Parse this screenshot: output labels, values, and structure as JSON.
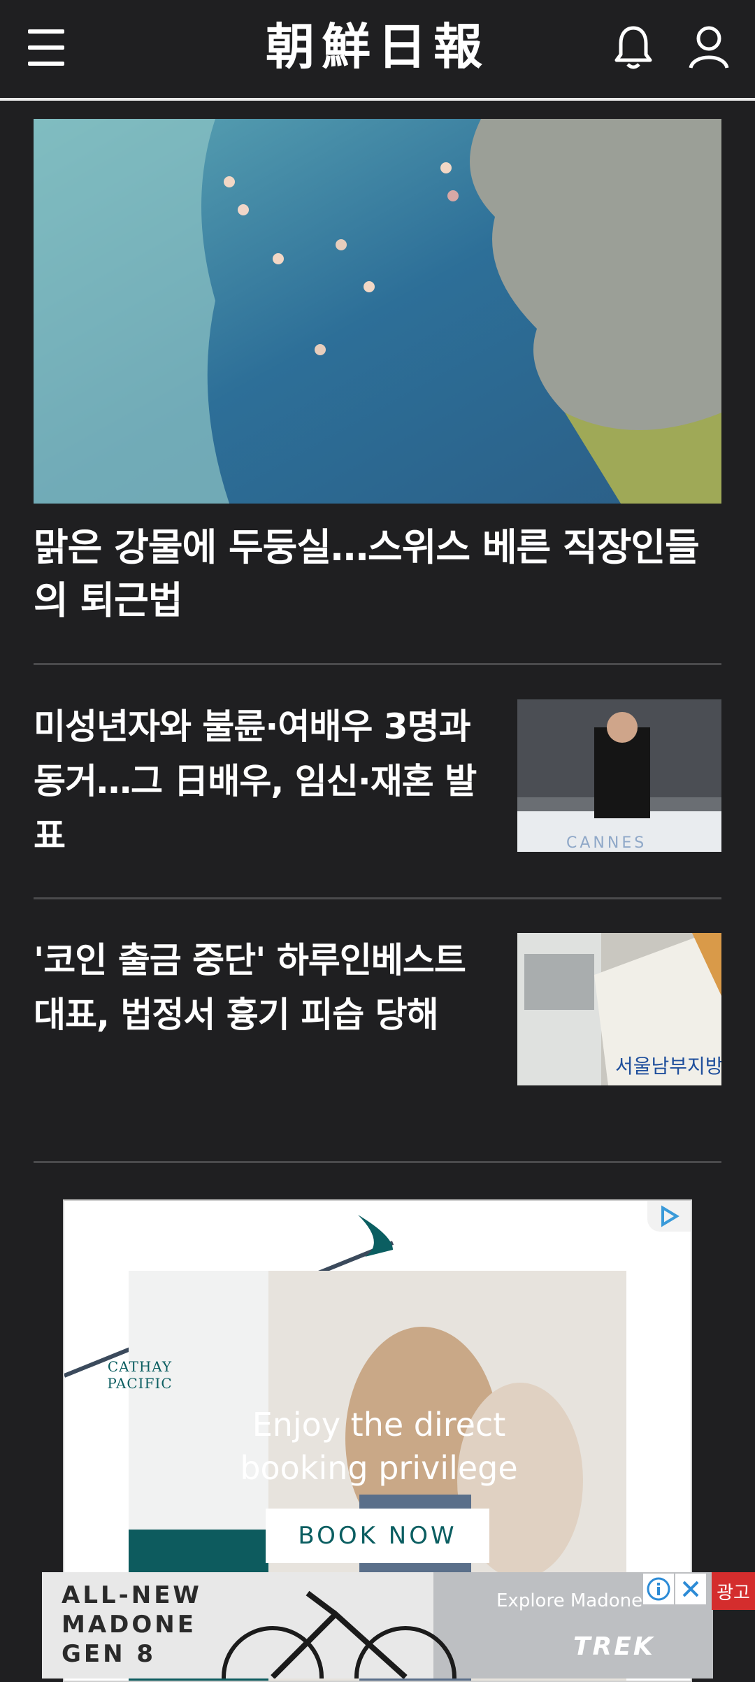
{
  "header": {
    "logo": "朝鮮日報",
    "menu_icon": "menu-icon",
    "bell_icon": "bell-icon",
    "user_icon": "user-icon"
  },
  "main_article": {
    "headline": "맑은 강물에 두둥실…스위스 베른 직장인들의 퇴근법",
    "image": "aerial river swimmers photo"
  },
  "articles": [
    {
      "headline": "미성년자와 불륜·여배우 3명과 동거…그 日배우, 임신·재혼 발표",
      "image": "actor at cannes photo"
    },
    {
      "headline": "'코인 출금 중단' 하루인베스트 대표, 법정서 흉기 피습 당해",
      "image": "seoul district court sign photo"
    }
  ],
  "ad_cathay": {
    "brand": "CATHAY PACIFIC",
    "line1": "Enjoy the direct",
    "line2": "booking privilege",
    "cta": "BOOK NOW"
  },
  "ad_banner": {
    "line1": "ALL-NEW",
    "line2": "MADONE",
    "line3": "GEN 8",
    "explore": "Explore Madone",
    "brand": "TREK",
    "label": "광고"
  },
  "colors": {
    "background": "#1f1f21",
    "accent_teal": "#0b5e61",
    "ad_label_red": "#d42d2d"
  }
}
